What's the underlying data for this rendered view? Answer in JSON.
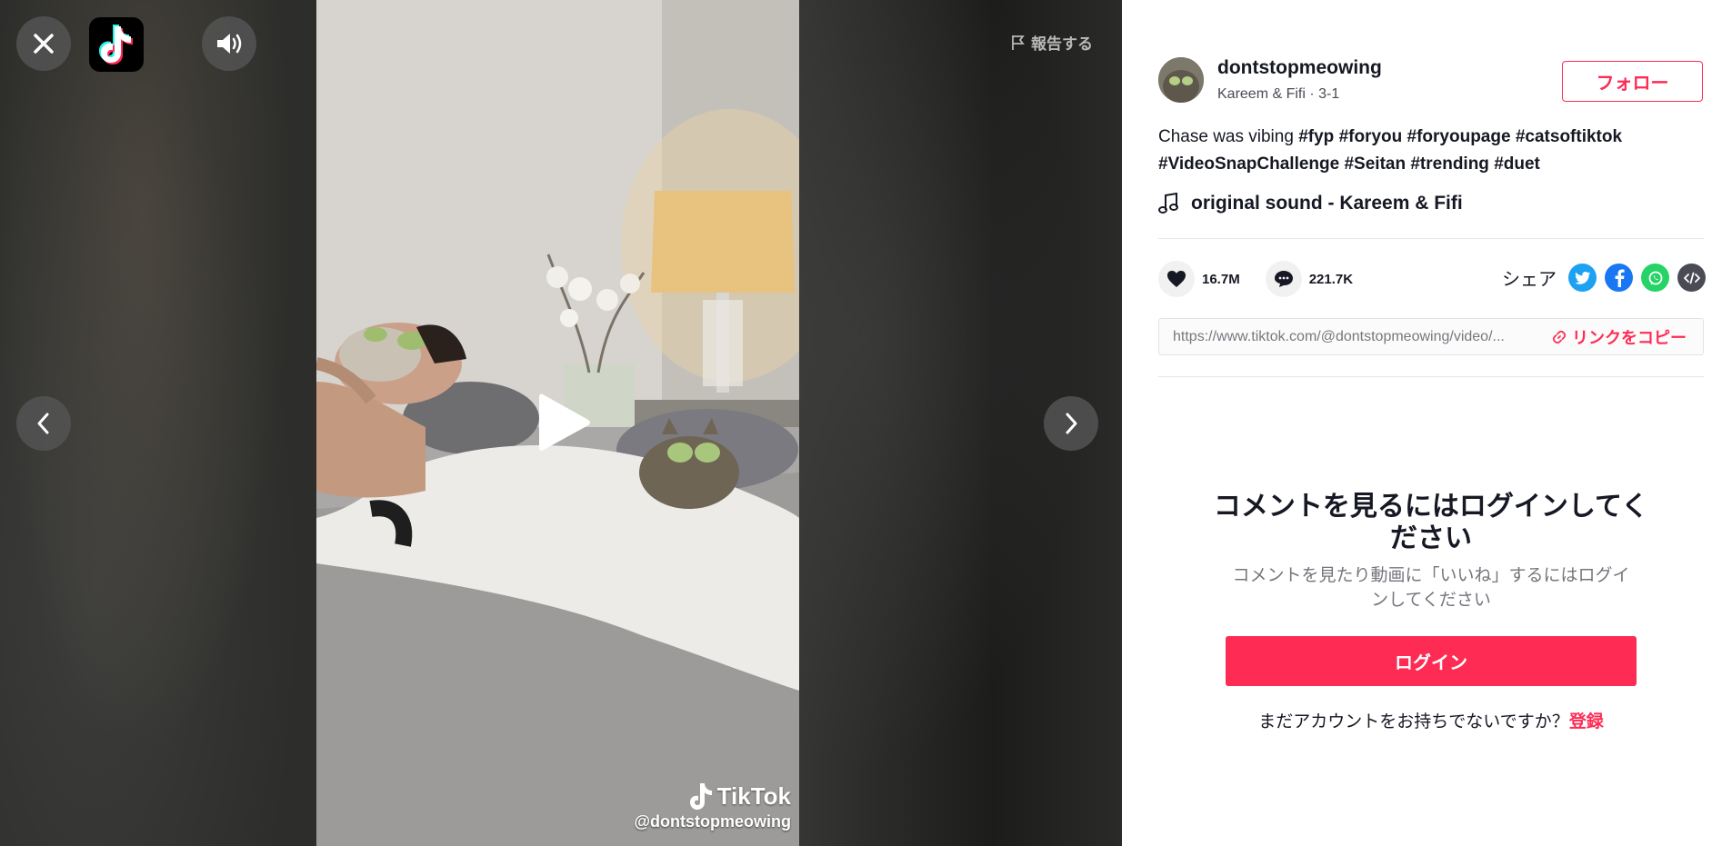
{
  "player": {
    "report_label": "報告する",
    "watermark_brand": "TikTok",
    "watermark_handle": "@dontstopmeowing"
  },
  "author": {
    "username": "dontstopmeowing",
    "subline": "Kareem & Fifi · 3-1",
    "follow_label": "フォロー"
  },
  "description": {
    "text": "Chase was vibing ",
    "hashtags": [
      "#fyp",
      "#foryou",
      "#foryoupage",
      "#catsoftiktok",
      "#VideoSnapChallenge",
      "#Seitan",
      "#trending",
      "#duet"
    ]
  },
  "music": {
    "title": "original sound - Kareem & Fifi"
  },
  "stats": {
    "likes": "16.7M",
    "comments": "221.7K"
  },
  "share": {
    "label": "シェア",
    "icons": [
      "twitter-icon",
      "facebook-icon",
      "whatsapp-icon",
      "embed-icon"
    ],
    "colors": {
      "twitter": "#1da1f2",
      "facebook": "#1877f2",
      "whatsapp": "#25d366",
      "embed": "#4a4b55"
    }
  },
  "link": {
    "url": "https://www.tiktok.com/@dontstopmeowing/video/...",
    "copy_label": "リンクをコピー"
  },
  "login": {
    "title": "コメントを見るにはログインしてください",
    "subtitle": "コメントを見たり動画に「いいね」するにはログインしてください",
    "button_label": "ログイン",
    "signup_prompt": "まだアカウントをお持ちでないですか？",
    "signup_link": "登録"
  },
  "colors": {
    "accent": "#fe2c55",
    "text": "#161823"
  }
}
